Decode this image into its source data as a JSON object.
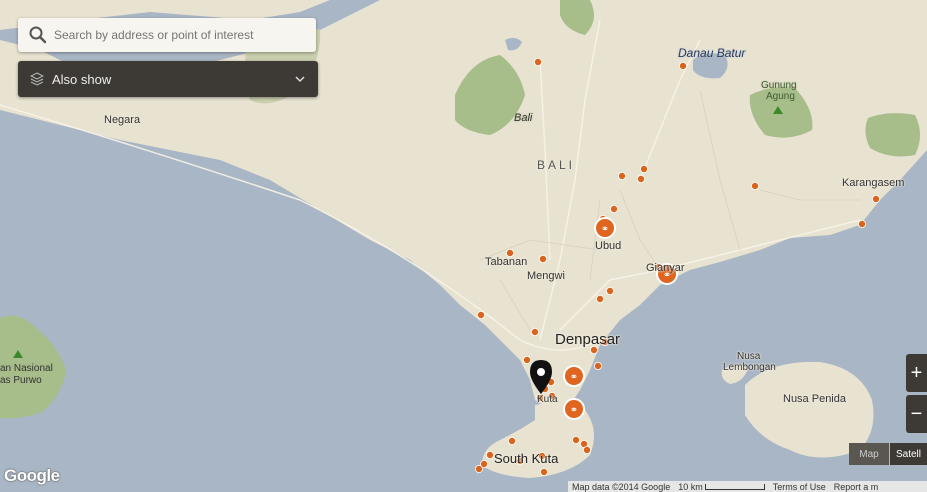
{
  "search": {
    "placeholder": "Search by address or point of interest"
  },
  "also_show": {
    "label": "Also show"
  },
  "labels": {
    "negara": "Negara",
    "bali_italic": "Bali",
    "bali_region": "BALI",
    "danau_batur": "Danau Batur",
    "gunung": "Gunung",
    "agung": "Agung",
    "karangasem": "Karangasem",
    "tabanan": "Tabanan",
    "mengwi": "Mengwi",
    "ubud": "Ubud",
    "gianyar": "Gianyar",
    "denpasar": "Denpasar",
    "kuta": "Kuta",
    "nusa": "Nusa",
    "lembongan": "Lembongan",
    "nusa_penida": "Nusa Penida",
    "south_kuta": "South Kuta",
    "taman_nasional": "an Nasional",
    "bali_barat": "as Purwo"
  },
  "controls": {
    "zoom_in": "+",
    "zoom_out": "−",
    "map": "Map",
    "satellite": "Satell"
  },
  "footer": {
    "map_data": "Map data ©2014 Google",
    "scale": "10 km",
    "terms": "Terms of Use",
    "report": "Report a m"
  },
  "logo": "Google",
  "colors": {
    "water": "#a9b6c5",
    "land": "#e8e2d1",
    "forest": "#a7bd8a",
    "marker": "#e0651e",
    "panel": "#3d3a35"
  }
}
